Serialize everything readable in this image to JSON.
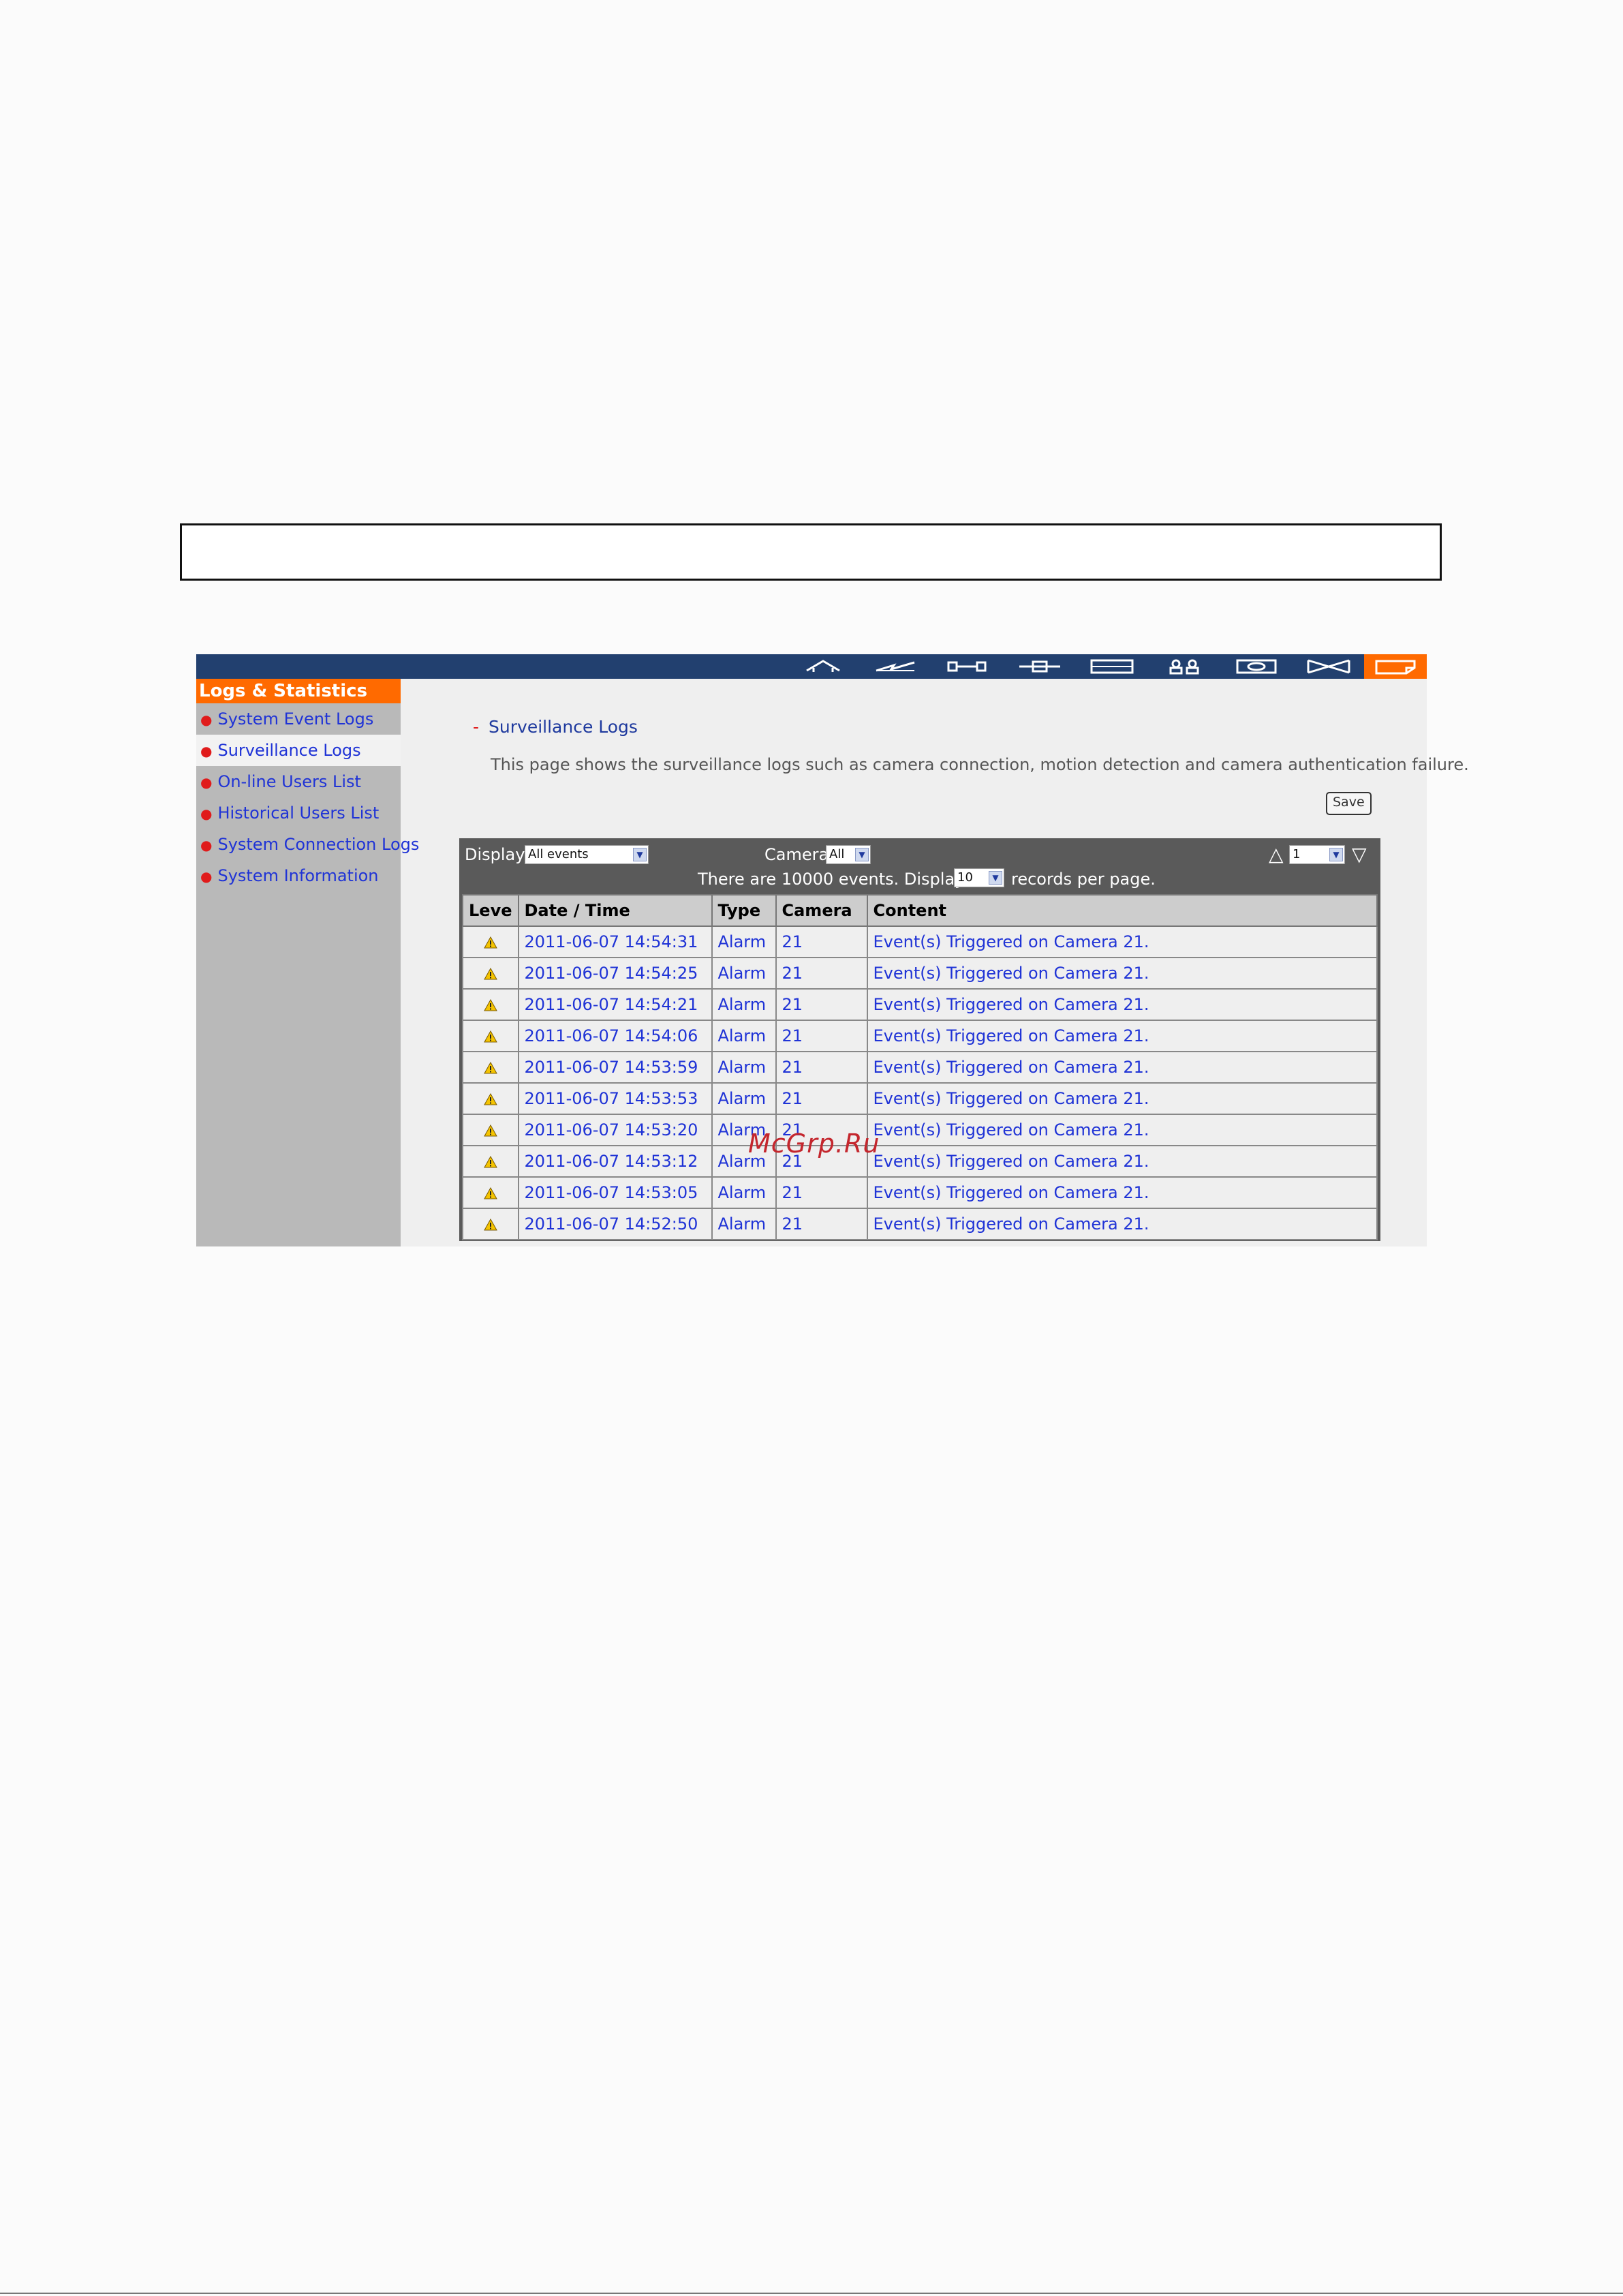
{
  "header_box": {
    "text": ""
  },
  "toolbar": {
    "icons": [
      "home-icon",
      "power-icon",
      "network-icon",
      "device-icon",
      "storage-icon",
      "users-icon",
      "camera-icon",
      "network-service-icon",
      "logs-icon"
    ],
    "active_color": "#ff6a00",
    "bar_color": "#22406f"
  },
  "sidebar": {
    "title": "Logs & Statistics",
    "items": [
      {
        "label": "System Event Logs"
      },
      {
        "label": "Surveillance Logs"
      },
      {
        "label": "On-line Users List"
      },
      {
        "label": "Historical Users List"
      },
      {
        "label": "System Connection Logs"
      },
      {
        "label": "System Information"
      }
    ]
  },
  "main": {
    "section_dash": "-",
    "section_title": "Surveillance Logs",
    "description": "This page shows the surveillance logs such as camera connection, motion detection and camera authentication failure.",
    "save_label": "Save",
    "filters": {
      "display_label": "Display",
      "display_value": "All events",
      "camera_label": "Camera",
      "camera_value": "All",
      "page_value": "1",
      "summary_prefix": "There are 10000 events.  Displays",
      "per_page_value": "10",
      "summary_suffix": "records per page."
    },
    "table": {
      "headers": [
        "Leve",
        "Date / Time",
        "Type",
        "Camera",
        "Content"
      ],
      "rows": [
        {
          "datetime": "2011-06-07 14:54:31",
          "type": "Alarm",
          "camera": "21",
          "content": "Event(s) Triggered on Camera 21."
        },
        {
          "datetime": "2011-06-07 14:54:25",
          "type": "Alarm",
          "camera": "21",
          "content": "Event(s) Triggered on Camera 21."
        },
        {
          "datetime": "2011-06-07 14:54:21",
          "type": "Alarm",
          "camera": "21",
          "content": "Event(s) Triggered on Camera 21."
        },
        {
          "datetime": "2011-06-07 14:54:06",
          "type": "Alarm",
          "camera": "21",
          "content": "Event(s) Triggered on Camera 21."
        },
        {
          "datetime": "2011-06-07 14:53:59",
          "type": "Alarm",
          "camera": "21",
          "content": "Event(s) Triggered on Camera 21."
        },
        {
          "datetime": "2011-06-07 14:53:53",
          "type": "Alarm",
          "camera": "21",
          "content": "Event(s) Triggered on Camera 21."
        },
        {
          "datetime": "2011-06-07 14:53:20",
          "type": "Alarm",
          "camera": "21",
          "content": "Event(s) Triggered on Camera 21."
        },
        {
          "datetime": "2011-06-07 14:53:12",
          "type": "Alarm",
          "camera": "21",
          "content": "Event(s) Triggered on Camera 21."
        },
        {
          "datetime": "2011-06-07 14:53:05",
          "type": "Alarm",
          "camera": "21",
          "content": "Event(s) Triggered on Camera 21."
        },
        {
          "datetime": "2011-06-07 14:52:50",
          "type": "Alarm",
          "camera": "21",
          "content": "Event(s) Triggered on Camera 21."
        }
      ]
    }
  },
  "watermark": "McGrp.Ru"
}
